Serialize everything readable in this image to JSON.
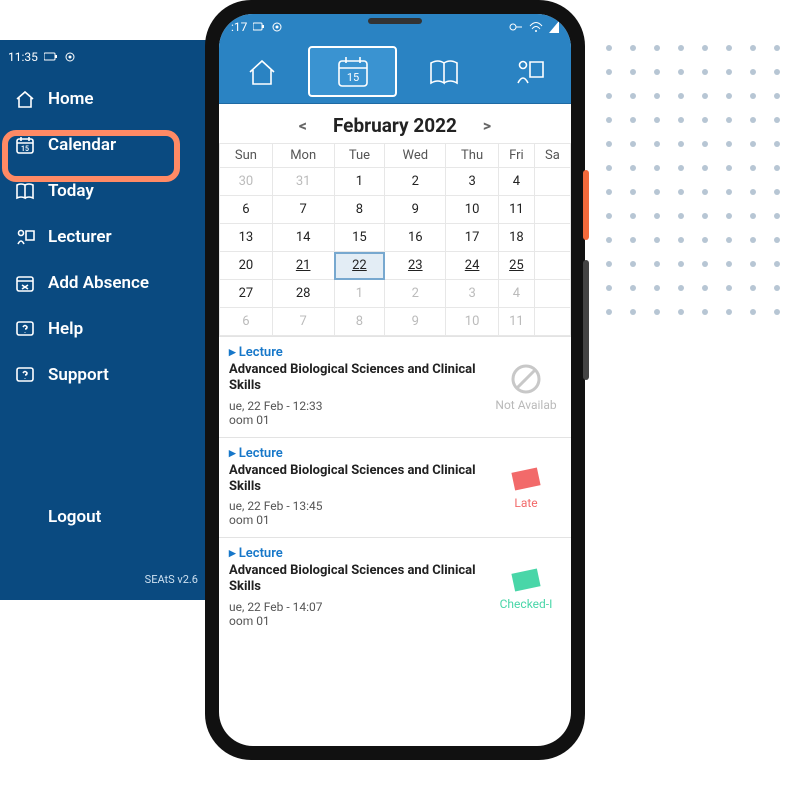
{
  "sidebar": {
    "time": "11:35",
    "items": [
      {
        "label": "Home"
      },
      {
        "label": "Calendar"
      },
      {
        "label": "Today"
      },
      {
        "label": "Lecturer"
      },
      {
        "label": "Add Absence"
      },
      {
        "label": "Help"
      },
      {
        "label": "Support"
      }
    ],
    "logout": "Logout",
    "version": "SEAtS v2.6",
    "highlighted_index": 1
  },
  "phone": {
    "status_time": ":17",
    "month_label": "February 2022",
    "weekdays": [
      "Sun",
      "Mon",
      "Tue",
      "Wed",
      "Thu",
      "Fri",
      "Sa"
    ],
    "grid": [
      [
        {
          "d": "30",
          "other": true
        },
        {
          "d": "31",
          "other": true
        },
        {
          "d": "1"
        },
        {
          "d": "2"
        },
        {
          "d": "3"
        },
        {
          "d": "4"
        },
        {
          "d": ""
        }
      ],
      [
        {
          "d": "6"
        },
        {
          "d": "7"
        },
        {
          "d": "8"
        },
        {
          "d": "9"
        },
        {
          "d": "10"
        },
        {
          "d": "11"
        },
        {
          "d": ""
        }
      ],
      [
        {
          "d": "13"
        },
        {
          "d": "14"
        },
        {
          "d": "15"
        },
        {
          "d": "16"
        },
        {
          "d": "17"
        },
        {
          "d": "18"
        },
        {
          "d": ""
        }
      ],
      [
        {
          "d": "20"
        },
        {
          "d": "21",
          "u": true
        },
        {
          "d": "22",
          "selected": true,
          "u": true
        },
        {
          "d": "23",
          "u": true
        },
        {
          "d": "24",
          "u": true
        },
        {
          "d": "25",
          "u": true
        },
        {
          "d": ""
        }
      ],
      [
        {
          "d": "27"
        },
        {
          "d": "28"
        },
        {
          "d": "1",
          "other": true
        },
        {
          "d": "2",
          "other": true
        },
        {
          "d": "3",
          "other": true
        },
        {
          "d": "4",
          "other": true
        },
        {
          "d": ""
        }
      ],
      [
        {
          "d": "6",
          "other": true
        },
        {
          "d": "7",
          "other": true
        },
        {
          "d": "8",
          "other": true
        },
        {
          "d": "9",
          "other": true
        },
        {
          "d": "10",
          "other": true
        },
        {
          "d": "11",
          "other": true
        },
        {
          "d": ""
        }
      ]
    ],
    "events": [
      {
        "tag": "Lecture",
        "title": "Advanced Biological Sciences and Clinical Skills",
        "datetime": "ue, 22 Feb - 12:33",
        "room": "oom 01",
        "status": "Not Availab",
        "status_kind": "na"
      },
      {
        "tag": "Lecture",
        "title": "Advanced Biological Sciences and Clinical Skills",
        "datetime": "ue, 22 Feb - 13:45",
        "room": "oom 01",
        "status": "Late",
        "status_kind": "late"
      },
      {
        "tag": "Lecture",
        "title": "Advanced Biological Sciences and Clinical Skills",
        "datetime": "ue, 22 Feb - 14:07",
        "room": "oom 01",
        "status": "Checked-I",
        "status_kind": "checked"
      }
    ]
  }
}
